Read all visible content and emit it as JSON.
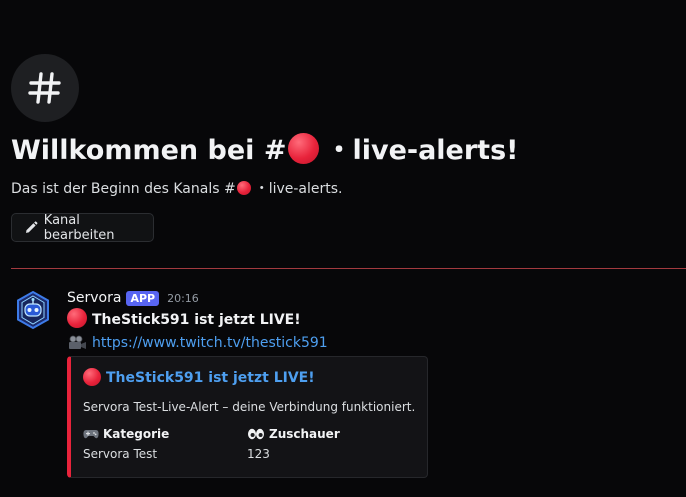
{
  "welcome": {
    "title_prefix": "Willkommen bei #",
    "title_suffix": "・live-alerts!",
    "subtitle_prefix": "Das ist der Beginn des Kanals #",
    "subtitle_suffix": "・live-alerts.",
    "edit_button": "Kanal bearbeiten"
  },
  "message": {
    "author": "Servora",
    "badge": "APP",
    "timestamp": "20:16",
    "headline": "TheStick591 ist jetzt LIVE!",
    "link": "https://www.twitch.tv/thestick591"
  },
  "embed": {
    "title": "TheStick591 ist jetzt LIVE!",
    "description": "Servora Test-Live-Alert – deine Verbindung funktioniert.",
    "fields": [
      {
        "name": "Kategorie",
        "value": "Servora Test",
        "icon": "game-controller-icon"
      },
      {
        "name": "Zuschauer",
        "value": "123",
        "icon": "eyes-icon"
      }
    ]
  },
  "colors": {
    "background": "#070709",
    "accent_red": "#e8233b",
    "link_blue": "#4e9ff0",
    "app_badge": "#5865f2",
    "divider": "#a33a3f"
  }
}
